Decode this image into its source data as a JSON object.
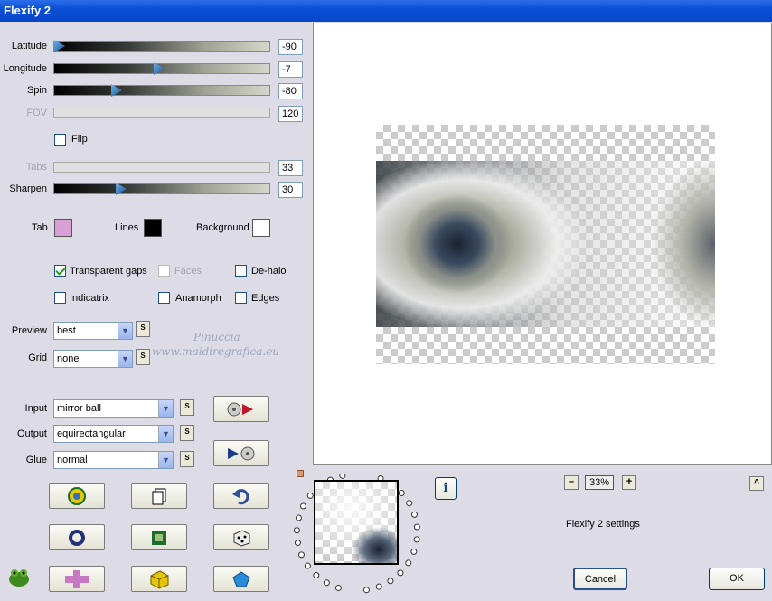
{
  "window": {
    "title": "Flexify 2"
  },
  "sliders": [
    {
      "label": "Latitude",
      "value": "-90",
      "level": 0.0,
      "enabled": true
    },
    {
      "label": "Longitude",
      "value": "-7",
      "level": 0.48,
      "enabled": true
    },
    {
      "label": "Spin",
      "value": "-80",
      "level": 0.28,
      "enabled": true
    },
    {
      "label": "FOV",
      "value": "120",
      "enabled": false
    },
    {
      "label": "Tabs",
      "value": "33",
      "enabled": false
    },
    {
      "label": "Sharpen",
      "value": "30",
      "level": 0.3,
      "enabled": true
    }
  ],
  "flip": {
    "label": "Flip",
    "checked": false
  },
  "colors": {
    "tab": {
      "label": "Tab",
      "color": "#d8a0d4"
    },
    "lines": {
      "label": "Lines",
      "color": "#000000"
    },
    "background": {
      "label": "Background",
      "color": "#ffffff"
    }
  },
  "options": {
    "transparent_gaps": {
      "label": "Transparent gaps",
      "checked": true
    },
    "faces": {
      "label": "Faces",
      "checked": false
    },
    "de_halo": {
      "label": "De-halo",
      "checked": false
    },
    "indicatrix": {
      "label": "Indicatrix",
      "checked": false
    },
    "anamorph": {
      "label": "Anamorph",
      "checked": false
    },
    "edges": {
      "label": "Edges",
      "checked": false
    }
  },
  "preview_sel": {
    "label": "Preview",
    "value": "best"
  },
  "grid_sel": {
    "label": "Grid",
    "value": "none"
  },
  "input_sel": {
    "label": "Input",
    "value": "mirror ball"
  },
  "output_sel": {
    "label": "Output",
    "value": "equirectangular"
  },
  "glue_sel": {
    "label": "Glue",
    "value": "normal"
  },
  "s_label": "S",
  "watermark": {
    "line1": "Pinuccia",
    "line2": "www.maidiregrafica.eu"
  },
  "zoom": {
    "minus": "–",
    "value": "33%",
    "plus": "+"
  },
  "collapse": "^",
  "status": "Flexify 2 settings",
  "buttons": {
    "cancel": "Cancel",
    "ok": "OK",
    "info": "i"
  },
  "icons": [
    "cd-play-icon",
    "play-cd-icon",
    "randomize-icon",
    "copy-icon",
    "undo-icon",
    "ring-icon",
    "square-icon",
    "dice-icon",
    "frog-icon",
    "cross-icon",
    "cube-icon",
    "gem-icon"
  ]
}
